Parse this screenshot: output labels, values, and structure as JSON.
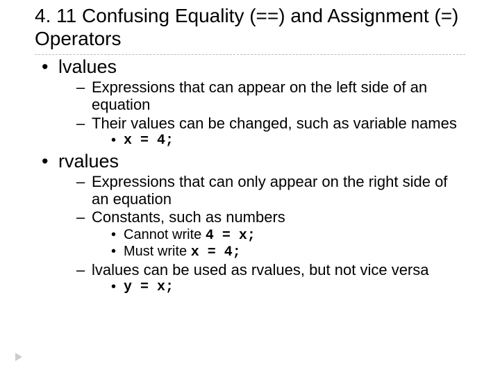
{
  "title": "4. 11 Confusing Equality (==) and Assignment (=) Operators",
  "b1_1": "lvalues",
  "b2_1": "Expressions that can appear on the left side of an equation",
  "b2_2": "Their values can be changed, such as variable names",
  "b3_code1": "x = 4;",
  "b1_2": "rvalues",
  "b2_3": "Expressions that can only appear on the right side of an equation",
  "b2_4": "Constants, such as numbers",
  "b3_2a": "Cannot write ",
  "b3_2a_code": "4 = x;",
  "b3_2b": "Must write ",
  "b3_2b_code": "x = 4;",
  "b2_5": "lvalues can be used as rvalues, but not vice versa",
  "b3_code3": "y = x;",
  "marks": {
    "dot": "•",
    "dash": "–"
  }
}
